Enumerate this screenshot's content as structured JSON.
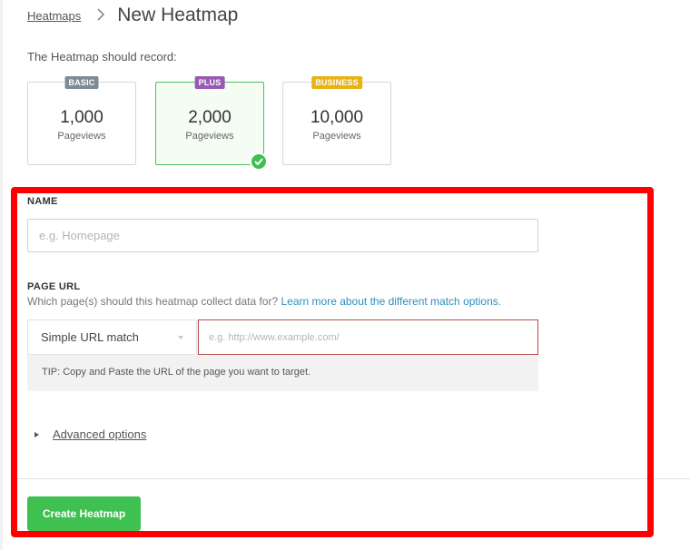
{
  "breadcrumb": {
    "parent_label": "Heatmaps",
    "separator": "›",
    "current_title": "New Heatmap"
  },
  "record": {
    "label": "The Heatmap should record:",
    "plans": [
      {
        "badge": "BASIC",
        "badge_color": "#7d8a97",
        "value": "1,000",
        "unit": "Pageviews",
        "selected": false
      },
      {
        "badge": "PLUS",
        "badge_color": "#9b59b6",
        "value": "2,000",
        "unit": "Pageviews",
        "selected": true
      },
      {
        "badge": "BUSINESS",
        "badge_color": "#e8b313",
        "value": "10,000",
        "unit": "Pageviews",
        "selected": false
      }
    ]
  },
  "form": {
    "name_label": "NAME",
    "name_placeholder": "e.g. Homepage",
    "page_url_label": "PAGE URL",
    "page_url_help": "Which page(s) should this heatmap collect data for?",
    "page_url_help_link": "Learn more about the different match options.",
    "match_type_selected": "Simple URL match",
    "url_placeholder": "e.g. http://www.example.com/",
    "tip": "TIP: Copy and Paste the URL of the page you want to target.",
    "advanced_options_label": "Advanced options",
    "create_button_label": "Create Heatmap"
  },
  "colors": {
    "accent_green": "#3fc152",
    "link_blue": "#2f8fbf",
    "error_border": "#b94a48",
    "highlight_red": "#ff0000"
  }
}
